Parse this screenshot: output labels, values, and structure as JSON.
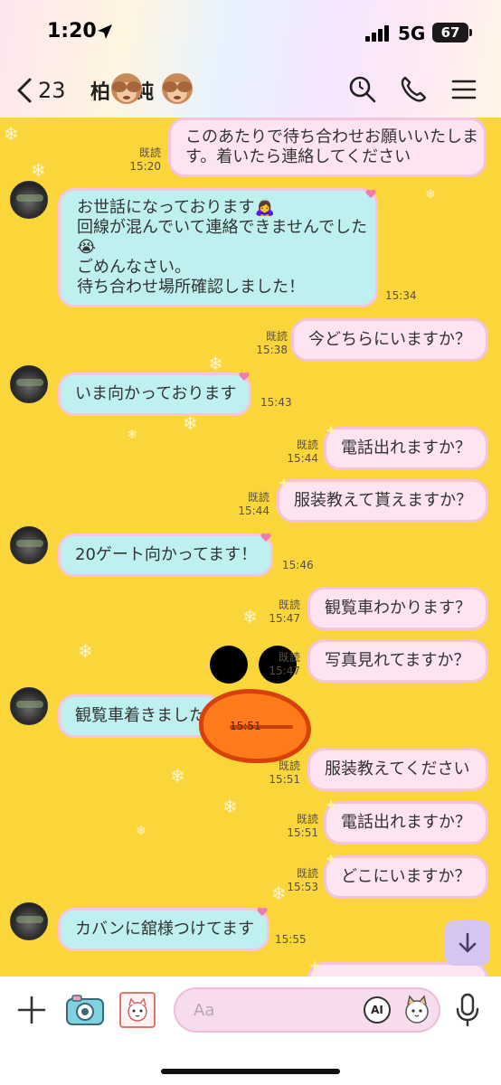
{
  "status_bar": {
    "time": "1:20",
    "network": "5G",
    "battery": "67"
  },
  "header": {
    "back_count": "23",
    "chat_name_start": "柏",
    "chat_name_middle": "純"
  },
  "colors": {
    "chat_background": "#fbd63a",
    "incoming_bubble": "#bff0f0",
    "outgoing_bubble": "#fde4f0",
    "bubble_border": "#f6c6e0",
    "scroll_button": "#d7c5f1"
  },
  "messages": [
    {
      "side": "out",
      "lines": [
        "このあたりで待ち合わせお願いいたしま",
        "す。着いたら連絡してください"
      ],
      "read": "既読",
      "time": "15:20"
    },
    {
      "side": "in",
      "lines": [
        "お世話になっております🙇‍♀️",
        "回線が混んでいて連絡できませんでした",
        "😭",
        "ごめんなさい。",
        "待ち合わせ場所確認しました！"
      ],
      "time": "15:34"
    },
    {
      "side": "out",
      "lines": [
        "今どちらにいますか？"
      ],
      "read": "既読",
      "time": "15:38"
    },
    {
      "side": "in",
      "lines": [
        "いま向かっております"
      ],
      "time": "15:43"
    },
    {
      "side": "out",
      "lines": [
        "電話出れますか？"
      ],
      "read": "既読",
      "time": "15:44"
    },
    {
      "side": "out",
      "lines": [
        "服装教えて貰えますか？"
      ],
      "read": "既読",
      "time": "15:44"
    },
    {
      "side": "in",
      "lines": [
        "20ゲート向かってます！"
      ],
      "time": "15:46"
    },
    {
      "side": "out",
      "lines": [
        "観覧車わかります？"
      ],
      "read": "既読",
      "time": "15:47"
    },
    {
      "side": "out",
      "lines": [
        "写真見れてますか？"
      ],
      "read": "既読",
      "time": "15:47"
    },
    {
      "side": "in",
      "lines": [
        "観覧車着きました"
      ],
      "time": "15:51"
    },
    {
      "side": "out",
      "lines": [
        "服装教えてください"
      ],
      "read": "既読",
      "time": "15:51"
    },
    {
      "side": "out",
      "lines": [
        "電話出れますか？"
      ],
      "read": "既読",
      "time": "15:51"
    },
    {
      "side": "out",
      "lines": [
        "どこにいますか？"
      ],
      "read": "既読",
      "time": "15:53"
    },
    {
      "side": "in",
      "lines": [
        "カバンに舘様つけてます"
      ],
      "time": "15:55"
    }
  ],
  "input": {
    "placeholder": "Aa",
    "ai_label": "AI"
  },
  "icons": [
    "back-chevron-icon",
    "search-icon",
    "phone-icon",
    "menu-icon",
    "plus-icon",
    "camera-icon",
    "album-icon",
    "ai-icon",
    "emoji-icon",
    "mic-icon",
    "scroll-down-icon"
  ]
}
